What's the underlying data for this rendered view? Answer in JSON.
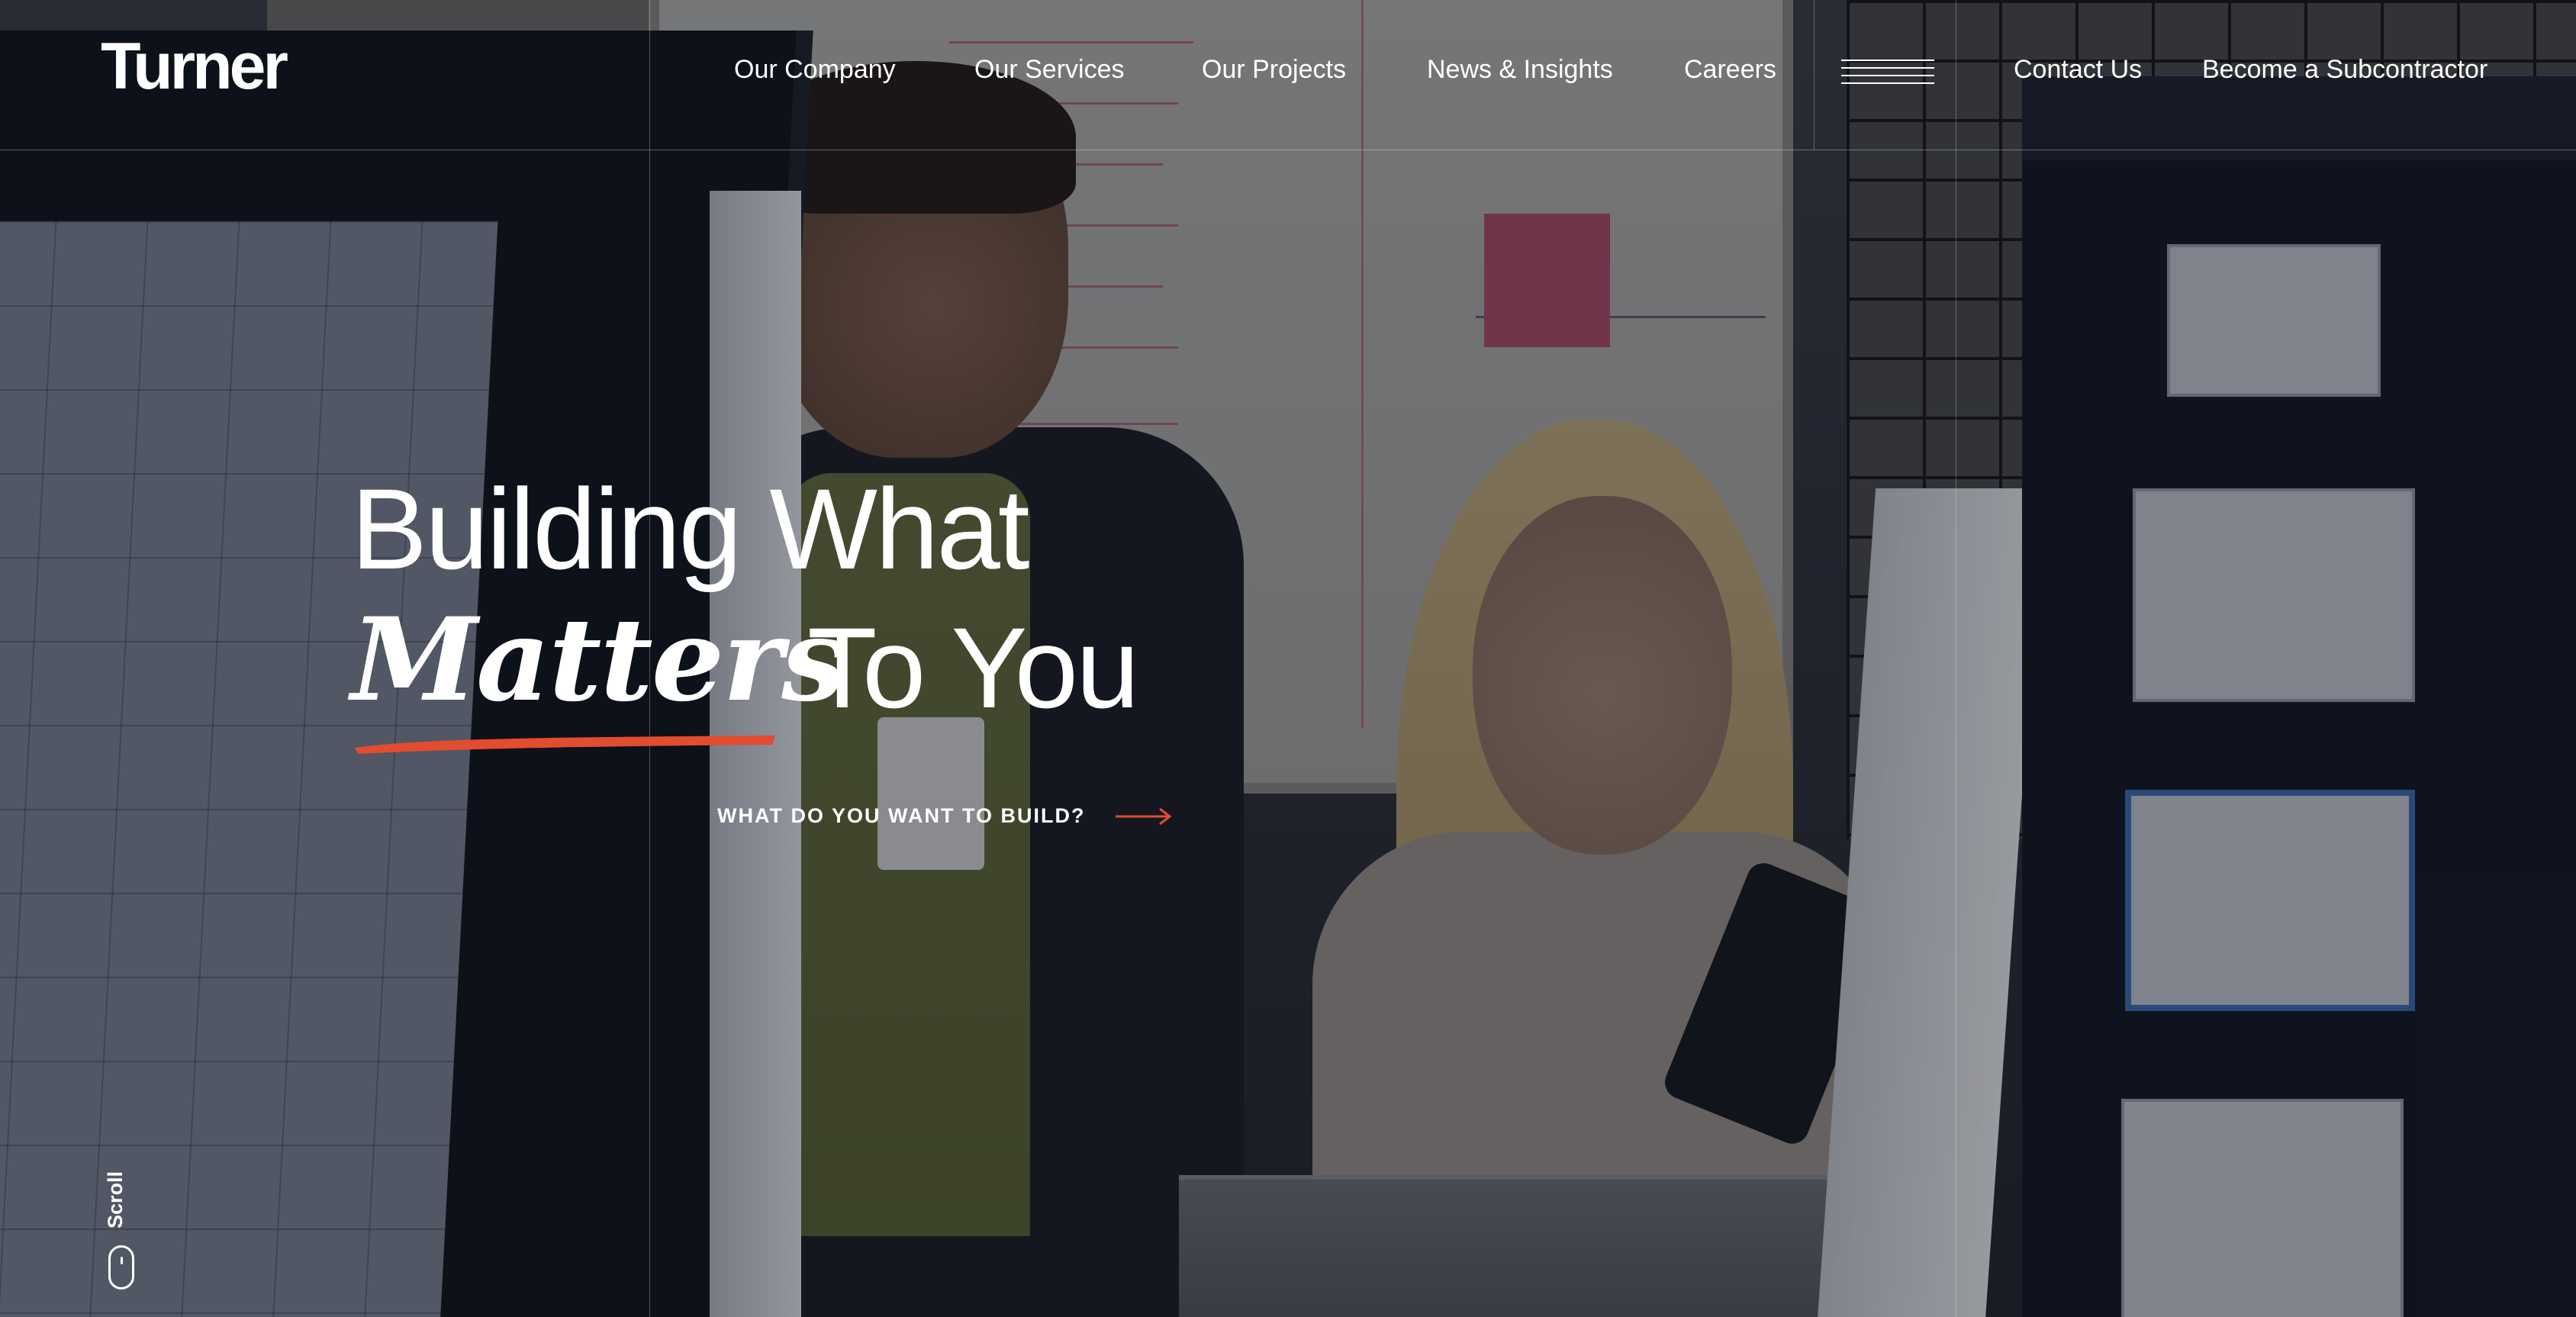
{
  "brand": {
    "logo_text": "Turner",
    "accent_color": "#e24c2f"
  },
  "nav": {
    "items": [
      {
        "label": "Our Company"
      },
      {
        "label": "Our Services"
      },
      {
        "label": "Our Projects"
      },
      {
        "label": "News & Insights"
      },
      {
        "label": "Careers"
      }
    ],
    "menu_icon": "hamburger-menu-icon",
    "contact_label": "Contact Us",
    "subcontractor_label": "Become a Subcontractor"
  },
  "hero": {
    "headline_line1": "Building What",
    "headline_script_word": "Matters",
    "headline_line2_rest": "To You",
    "cta_label": "WHAT DO YOU WANT TO BUILD?",
    "cta_icon": "arrow-right-icon"
  },
  "scroll": {
    "label": "Scroll",
    "icon": "mouse-scroll-icon"
  }
}
